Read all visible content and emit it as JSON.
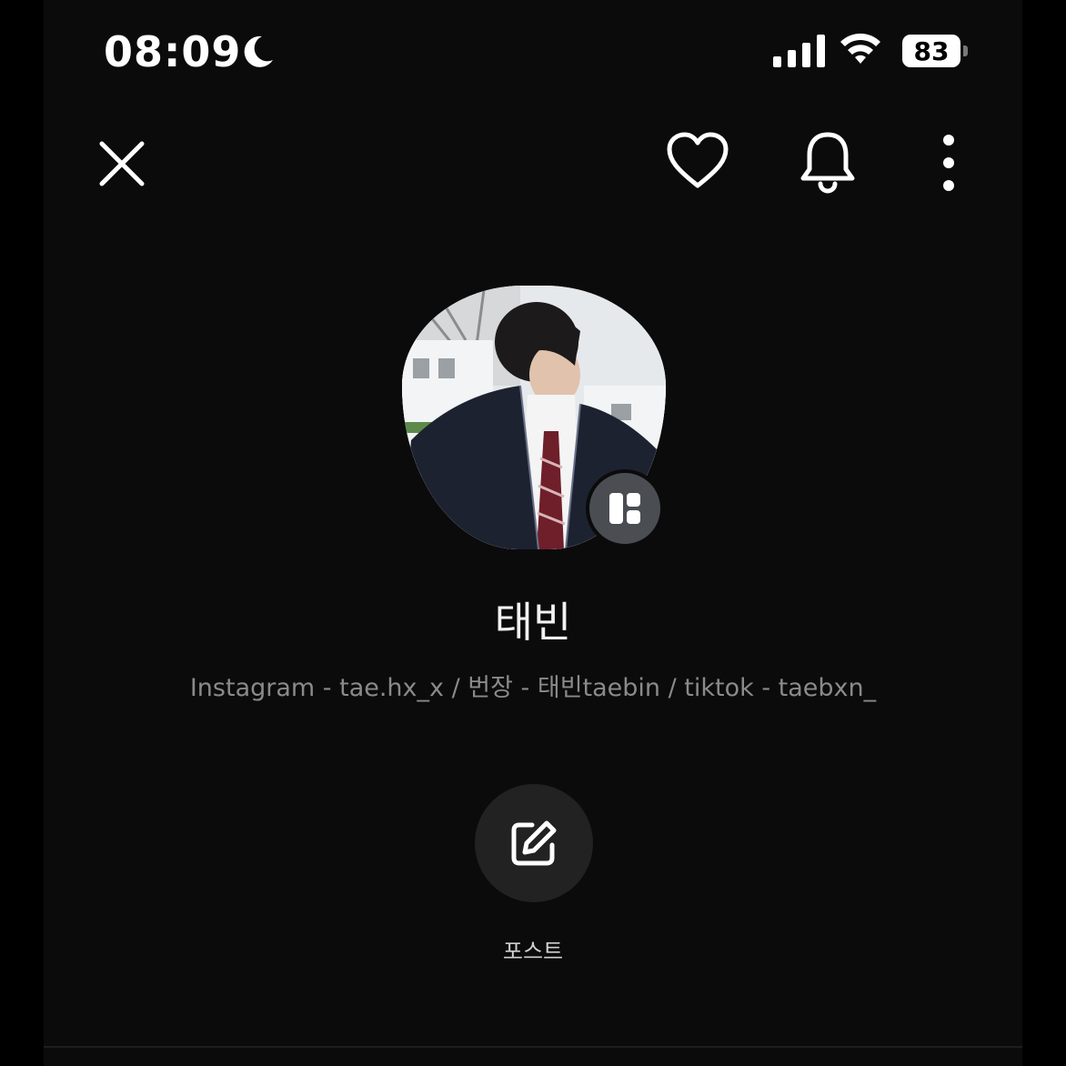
{
  "status_bar": {
    "time": "08:09",
    "battery": "83",
    "icons": [
      "moon-icon",
      "signal-icon",
      "wifi-icon",
      "battery-icon"
    ]
  },
  "top_bar": {
    "icons": [
      "close-icon",
      "heart-icon",
      "bell-icon",
      "more-vertical-icon"
    ]
  },
  "profile": {
    "name": "태빈",
    "bio": "Instagram - tae.hx_x / 번장 - 태빈taebin / tiktok - taebxn_",
    "badge_icon": "layout-grid-icon"
  },
  "actions": {
    "post_label": "포스트",
    "post_icon": "edit-icon"
  },
  "colors": {
    "background": "#0b0b0b",
    "text_primary": "#f2f2f2",
    "text_secondary": "#8a8a8a",
    "button_bg": "#222222",
    "badge_bg": "#4a4d52"
  }
}
